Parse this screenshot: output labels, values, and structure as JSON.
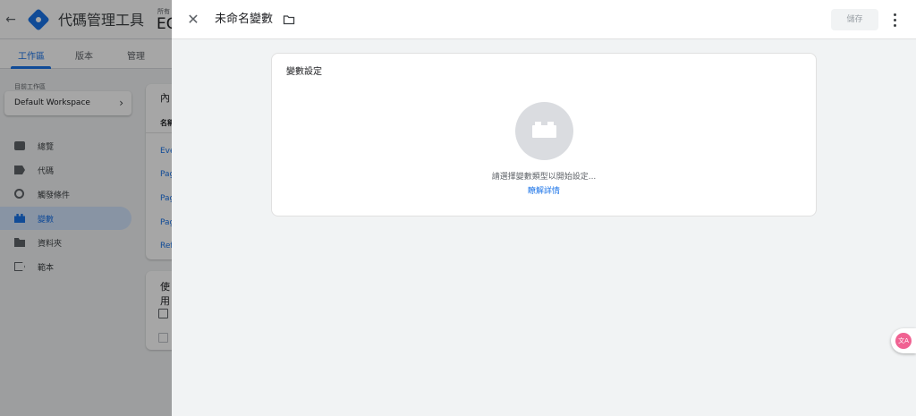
{
  "background": {
    "app_title": "代碼管理工具",
    "account_label": "所有",
    "account_name": "EC",
    "tabs": [
      {
        "label": "工作區",
        "active": true
      },
      {
        "label": "版本",
        "active": false
      },
      {
        "label": "管理",
        "active": false
      }
    ],
    "workspace_caption": "目前工作區",
    "workspace_name": "Default Workspace",
    "nav": [
      {
        "label": "總覽",
        "icon": "overview-icon",
        "active": false
      },
      {
        "label": "代碼",
        "icon": "tag-icon",
        "active": false
      },
      {
        "label": "觸發條件",
        "icon": "trigger-icon",
        "active": false
      },
      {
        "label": "變數",
        "icon": "variable-icon",
        "active": true
      },
      {
        "label": "資料夾",
        "icon": "folder-icon",
        "active": false
      },
      {
        "label": "範本",
        "icon": "template-icon",
        "active": false
      }
    ],
    "content_card": {
      "title": "內",
      "column": "名稱",
      "rows": [
        "Eve",
        "Pag",
        "Pag",
        "Pag",
        "Ref"
      ]
    },
    "usage_card": {
      "title": "使用"
    }
  },
  "panel": {
    "title": "未命名變數",
    "save_label": "儲存",
    "config_title": "變數設定",
    "hint": "請選擇變數類型以開始設定...",
    "learn_more": "瞭解詳情"
  },
  "colors": {
    "accent": "#1a73e8",
    "scrim": "rgba(0,0,0,0.35)"
  }
}
